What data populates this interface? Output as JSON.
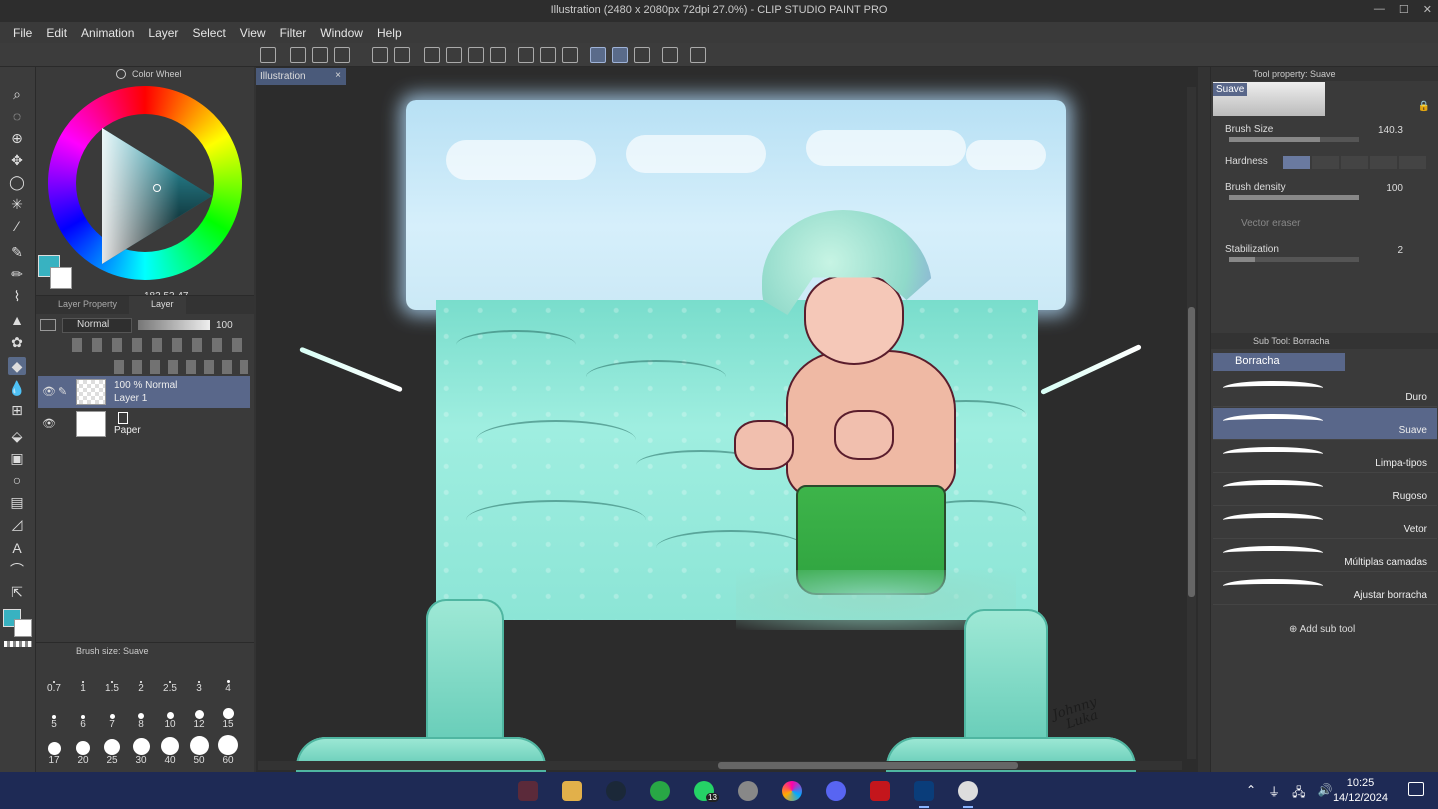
{
  "window": {
    "title": "Illustration (2480 x 2080px 72dpi 27.0%) - CLIP STUDIO PAINT PRO",
    "controls": [
      "—",
      "☐",
      "✕"
    ]
  },
  "menu": [
    "File",
    "Edit",
    "Animation",
    "Layer",
    "Select",
    "View",
    "Filter",
    "Window",
    "Help"
  ],
  "color_wheel": {
    "panel_title": "Color Wheel",
    "main_color": "#38b2c1",
    "sub_color": "#ffffff",
    "values": "183  53  47"
  },
  "layer_panel": {
    "tabs": [
      "Layer Property",
      "Layer"
    ],
    "blend_mode": "Normal",
    "opacity": "100",
    "layers": [
      {
        "line1": "100 % Normal",
        "line2": "Layer 1",
        "selected": true
      },
      {
        "line1": "",
        "line2": "Paper",
        "selected": false
      }
    ]
  },
  "brush_size_panel": {
    "title": "Brush size: Suave",
    "sizes": [
      "0.7",
      "1",
      "1.5",
      "2",
      "2.5",
      "3",
      "4",
      "5",
      "6",
      "7",
      "8",
      "10",
      "12",
      "15",
      "17",
      "20",
      "25",
      "30",
      "40",
      "50",
      "60"
    ]
  },
  "document": {
    "tab_label": "Illustration",
    "tab_close": "×",
    "signature_line1": "Johnny",
    "signature_line2": "Luka"
  },
  "tool_property": {
    "title": "Tool property: Suave",
    "brush_name": "Suave",
    "brush_size_label": "Brush Size",
    "brush_size_value": "140.3",
    "hardness_label": "Hardness",
    "density_label": "Brush density",
    "density_value": "100",
    "vector_eraser_label": "Vector eraser",
    "stabilization_label": "Stabilization",
    "stabilization_value": "2"
  },
  "sub_tool": {
    "title": "Sub Tool: Borracha",
    "group": "Borracha",
    "items": [
      {
        "name": "Duro",
        "selected": false
      },
      {
        "name": "Suave",
        "selected": true
      },
      {
        "name": "Limpa-tipos",
        "selected": false
      },
      {
        "name": "Rugoso",
        "selected": false
      },
      {
        "name": "Vetor",
        "selected": false
      },
      {
        "name": "Múltiplas camadas",
        "selected": false
      },
      {
        "name": "Ajustar borracha",
        "selected": false
      }
    ],
    "add_label": "Add sub tool"
  },
  "taskbar": {
    "time": "10:25",
    "date": "14/12/2024",
    "whatsapp_badge": "13"
  }
}
